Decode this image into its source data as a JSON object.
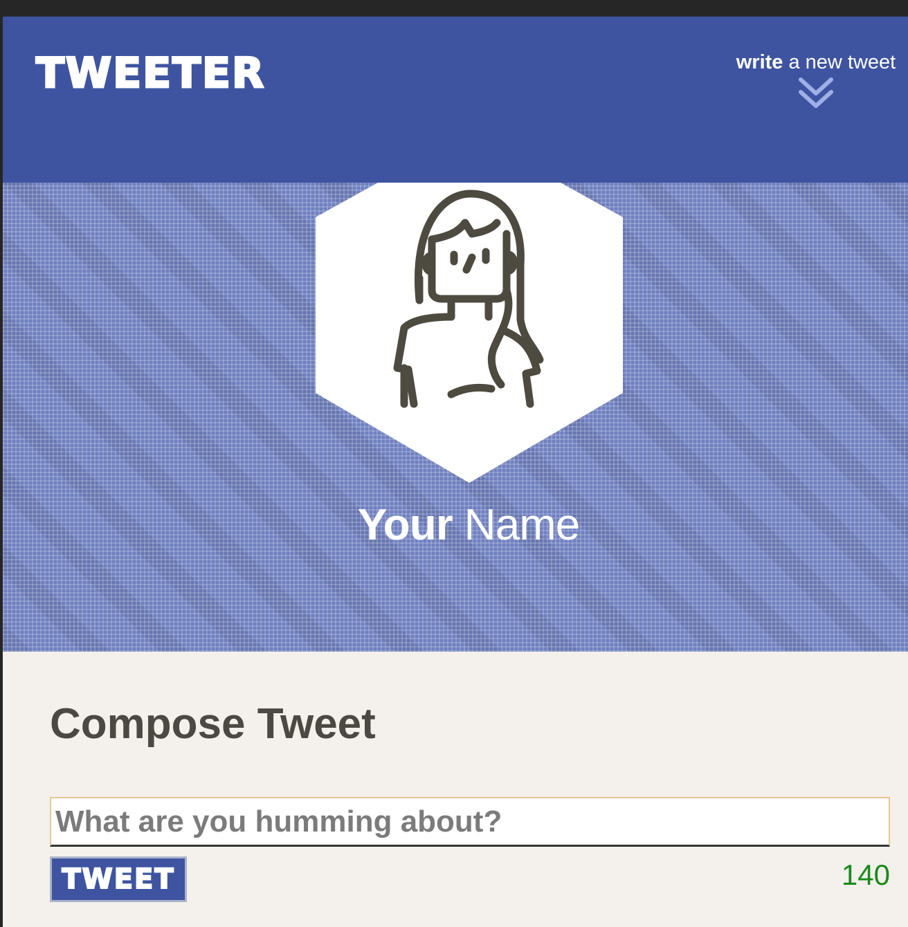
{
  "nav": {
    "brand": "TWEETER",
    "toggle_strong": "write",
    "toggle_rest": " a new tweet",
    "toggle_icon": "double-chevron-down-icon"
  },
  "profile": {
    "avatar_icon": "user-avatar-icon",
    "name_first": "Your",
    "name_last": " Name"
  },
  "compose": {
    "title": "Compose Tweet",
    "placeholder": "What are you humming about?",
    "value": "",
    "button_label": "TWEET",
    "counter": "140"
  },
  "colors": {
    "brand": "#3e54a0",
    "background": "#f4f1ec",
    "counter": "#1a8a1a",
    "heading": "#4b4942"
  }
}
